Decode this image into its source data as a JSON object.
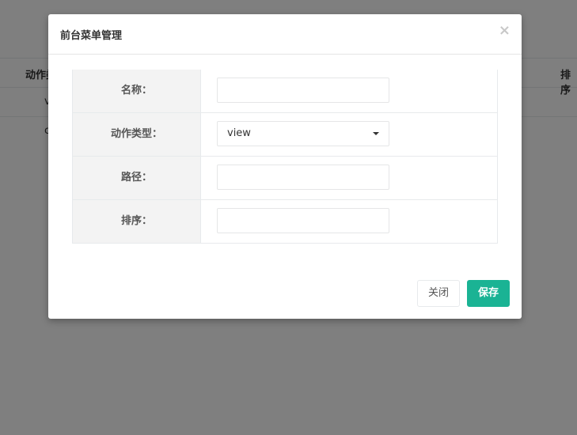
{
  "background": {
    "columns": [
      "动作类型",
      "排序"
    ],
    "rows": [
      {
        "cell": "v"
      },
      {
        "cell": "c"
      }
    ]
  },
  "modal": {
    "title": "前台菜单管理",
    "close_symbol": "×",
    "fields": {
      "name": {
        "label": "名称：",
        "value": ""
      },
      "action_type": {
        "label": "动作类型：",
        "value": "view"
      },
      "path": {
        "label": "路径：",
        "value": ""
      },
      "order": {
        "label": "排序：",
        "value": ""
      }
    },
    "buttons": {
      "close": "关闭",
      "save": "保存"
    }
  },
  "colors": {
    "accent": "#1ab394",
    "overlay": "#000000"
  }
}
